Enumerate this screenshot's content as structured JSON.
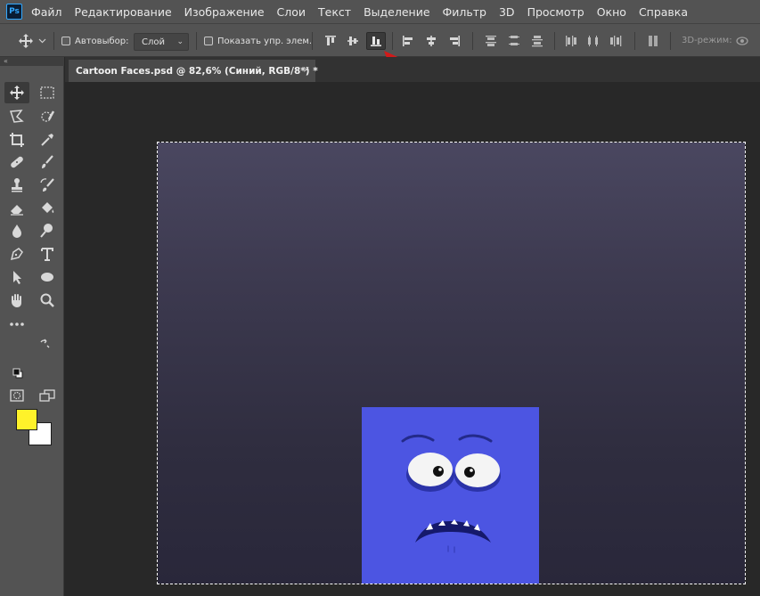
{
  "app": {
    "logo": "Ps"
  },
  "menu": [
    "Файл",
    "Редактирование",
    "Изображение",
    "Слои",
    "Текст",
    "Выделение",
    "Фильтр",
    "3D",
    "Просмотр",
    "Окно",
    "Справка"
  ],
  "options": {
    "autoselect_label": "Автовыбор:",
    "autoselect_value": "Слой",
    "show_transform_label": "Показать упр. элем.",
    "mode_3d_label": "3D-режим:"
  },
  "document": {
    "tab_title": "Cartoon Faces.psd @ 82,6% (Синий, RGB/8*) *",
    "close": "×"
  },
  "colors": {
    "foreground": "#fff22a",
    "background": "#ffffff",
    "layer_fill": "#4c55e2",
    "annotation_arrow": "#d11a1a"
  },
  "toolstrip": {
    "collapse": "«"
  }
}
